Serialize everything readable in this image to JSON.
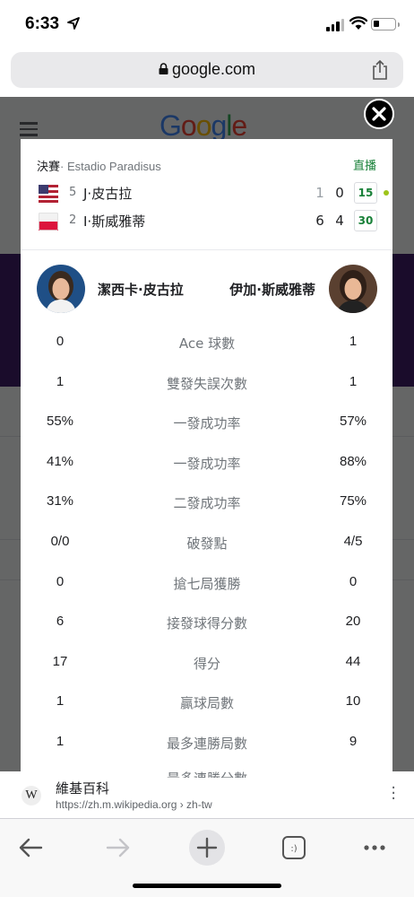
{
  "status_bar": {
    "time": "6:33"
  },
  "browser": {
    "url": "google.com"
  },
  "background_page": {
    "logo": "Google",
    "wiki_result": {
      "title": "維基百科",
      "url": "https://zh.m.wikipedia.org › zh-tw"
    }
  },
  "match_card": {
    "header": {
      "round": "決賽",
      "venue": "· Estadio Paradisus",
      "status": "直播"
    },
    "players": [
      {
        "flag": "US",
        "seed": "5",
        "name": "J·皮古拉",
        "set1": "1",
        "set2": "0",
        "points": "15",
        "serving": true
      },
      {
        "flag": "PL",
        "seed": "2",
        "name": "I·斯威雅蒂",
        "set1": "6",
        "set2": "4",
        "points": "30",
        "serving": false
      }
    ],
    "stats_header": {
      "left_player": "潔西卡·皮古拉",
      "right_player": "伊加·斯威雅蒂"
    },
    "stats": [
      {
        "left": "0",
        "label": "Ace 球數",
        "right": "1"
      },
      {
        "left": "1",
        "label": "雙發失誤次數",
        "right": "1"
      },
      {
        "left": "55%",
        "label": "一發成功率",
        "right": "57%"
      },
      {
        "left": "41%",
        "label": "一發成功率",
        "right": "88%"
      },
      {
        "left": "31%",
        "label": "二發成功率",
        "right": "75%"
      },
      {
        "left": "0/0",
        "label": "破發點",
        "right": "4/5"
      },
      {
        "left": "0",
        "label": "搶七局獲勝",
        "right": "0"
      },
      {
        "left": "6",
        "label": "接發球得分數",
        "right": "20"
      },
      {
        "left": "17",
        "label": "得分",
        "right": "44"
      },
      {
        "left": "1",
        "label": "贏球局數",
        "right": "10"
      },
      {
        "left": "1",
        "label": "最多連勝局數",
        "right": "9"
      }
    ],
    "partial_stat_label": "最多連勝分數"
  },
  "colors": {
    "live_green": "#188038",
    "serve_dot": "#9ec41a",
    "overlay": "#000000",
    "purple_band": "#3f1d67"
  },
  "icons": [
    "location-arrow-icon",
    "signal-icon",
    "wifi-icon",
    "battery-icon",
    "lock-icon",
    "share-icon",
    "close-icon",
    "back-icon",
    "forward-icon",
    "new-tab-icon",
    "tabs-icon",
    "more-icon"
  ]
}
